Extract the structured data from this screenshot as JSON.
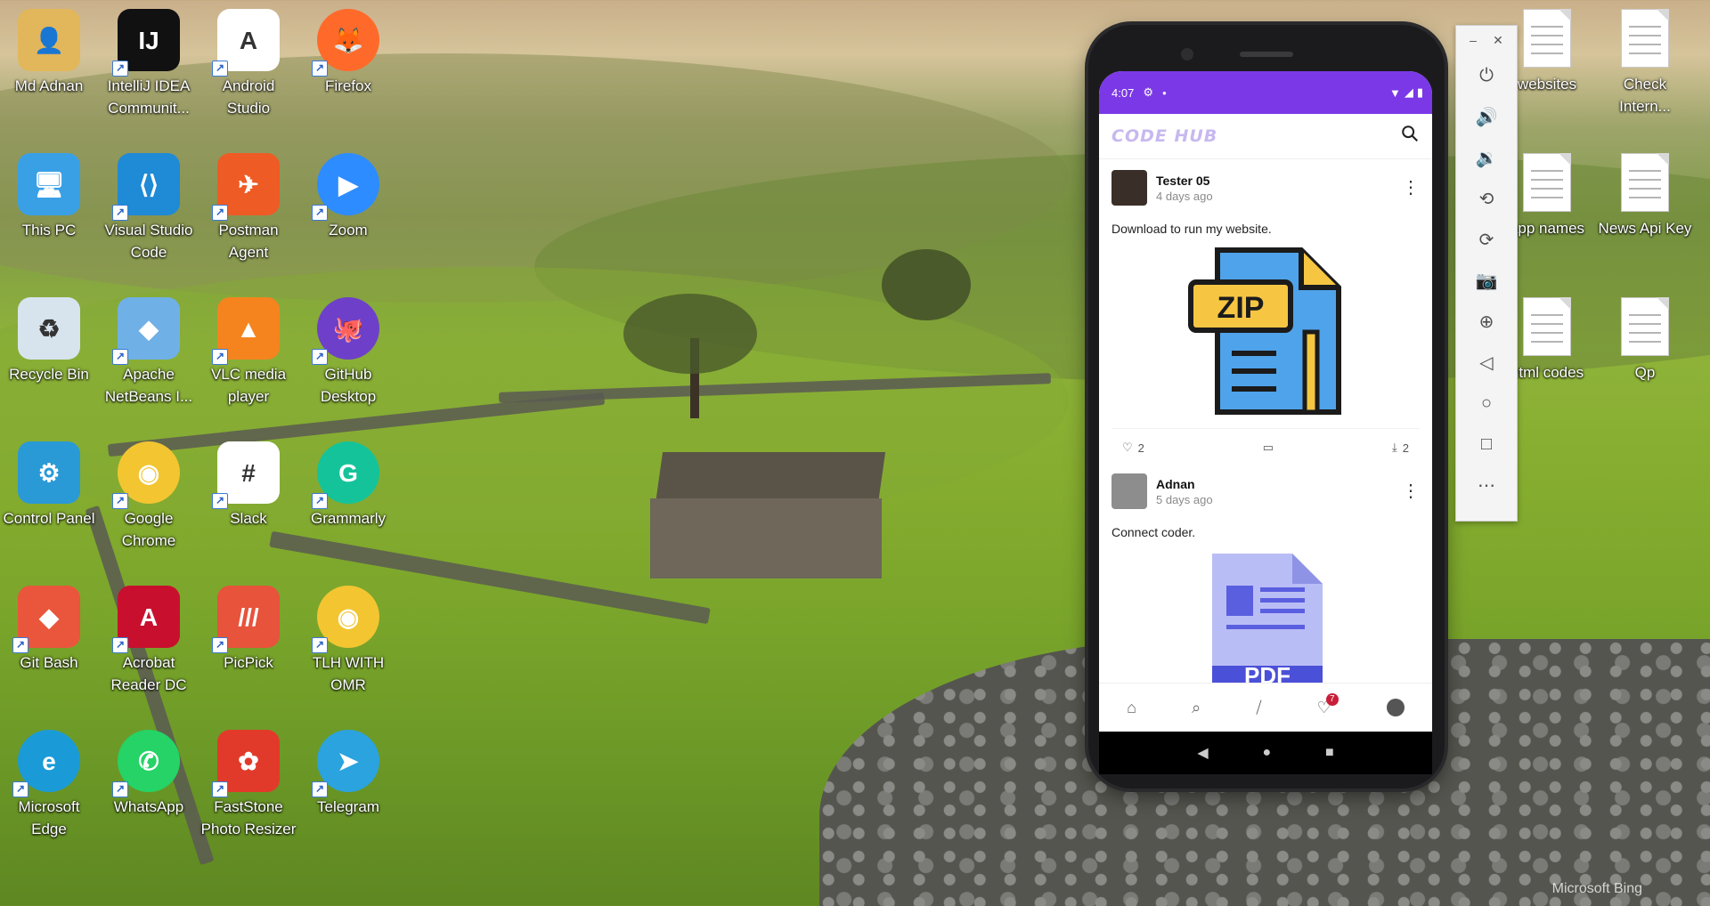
{
  "desktop": {
    "icons": [
      {
        "label": "Md Adnan",
        "glyph": "👤",
        "color": "#e2b65a"
      },
      {
        "label": "IntelliJ IDEA Communit...",
        "glyph": "IJ",
        "color": "#111111"
      },
      {
        "label": "Android Studio",
        "glyph": "A",
        "color": "#ffffff"
      },
      {
        "label": "Firefox",
        "glyph": "🦊",
        "color": "#ff6a2b"
      },
      {
        "label": "This PC",
        "glyph": "🖥",
        "color": "#3aa0e6"
      },
      {
        "label": "Visual Studio Code",
        "glyph": "⟨⟩",
        "color": "#1f8ad6"
      },
      {
        "label": "Postman Agent",
        "glyph": "✈",
        "color": "#ef5b25"
      },
      {
        "label": "Zoom",
        "glyph": "▶",
        "color": "#2d8cff"
      },
      {
        "label": "Recycle Bin",
        "glyph": "♻",
        "color": "#d7e4ee"
      },
      {
        "label": "Apache NetBeans I...",
        "glyph": "◆",
        "color": "#6fb0e6"
      },
      {
        "label": "VLC media player",
        "glyph": "▲",
        "color": "#f5841f"
      },
      {
        "label": "GitHub Desktop",
        "glyph": "🐙",
        "color": "#6e40c9"
      },
      {
        "label": "Control Panel",
        "glyph": "⚙",
        "color": "#2a9ad6"
      },
      {
        "label": "Google Chrome",
        "glyph": "◉",
        "color": "#f2c531"
      },
      {
        "label": "Slack",
        "glyph": "#",
        "color": "#ffffff"
      },
      {
        "label": "Grammarly",
        "glyph": "G",
        "color": "#15c39a"
      },
      {
        "label": "Git Bash",
        "glyph": "◆",
        "color": "#e9563b"
      },
      {
        "label": "Acrobat Reader DC",
        "glyph": "A",
        "color": "#c8102e"
      },
      {
        "label": "PicPick",
        "glyph": "///",
        "color": "#e7533b"
      },
      {
        "label": "TLH WITH OMR",
        "glyph": "◉",
        "color": "#f2c531"
      },
      {
        "label": "Microsoft Edge",
        "glyph": "e",
        "color": "#1a9bd7"
      },
      {
        "label": "WhatsApp",
        "glyph": "✆",
        "color": "#25d366"
      },
      {
        "label": "FastStone Photo Resizer",
        "glyph": "✿",
        "color": "#e23a2a"
      },
      {
        "label": "Telegram",
        "glyph": "➤",
        "color": "#2aa3df"
      }
    ],
    "right_icons": [
      {
        "label": "websites"
      },
      {
        "label": "Check Intern..."
      },
      {
        "label": "app names"
      },
      {
        "label": "News Api Key"
      },
      {
        "label": "html codes"
      },
      {
        "label": "Qp"
      }
    ],
    "watermark": "Microsoft Bing"
  },
  "phone": {
    "status": {
      "time": "4:07"
    },
    "app": {
      "logo": "CODE HUB"
    },
    "posts": [
      {
        "author": "Tester 05",
        "time": "4 days ago",
        "text": "Download to run my website.",
        "media": "ZIP",
        "likes": "2",
        "downloads": "2"
      },
      {
        "author": "Adnan",
        "time": "5 days ago",
        "text": "Connect coder.",
        "media": "PDF"
      }
    ],
    "bottom_nav": {
      "badge": "7"
    }
  },
  "emulator_toolbar": {
    "buttons": [
      "power-icon",
      "volume-up-icon",
      "volume-down-icon",
      "rotate-left-icon",
      "rotate-right-icon",
      "camera-icon",
      "zoom-icon",
      "back-icon",
      "home-icon",
      "overview-icon",
      "more-icon"
    ]
  }
}
